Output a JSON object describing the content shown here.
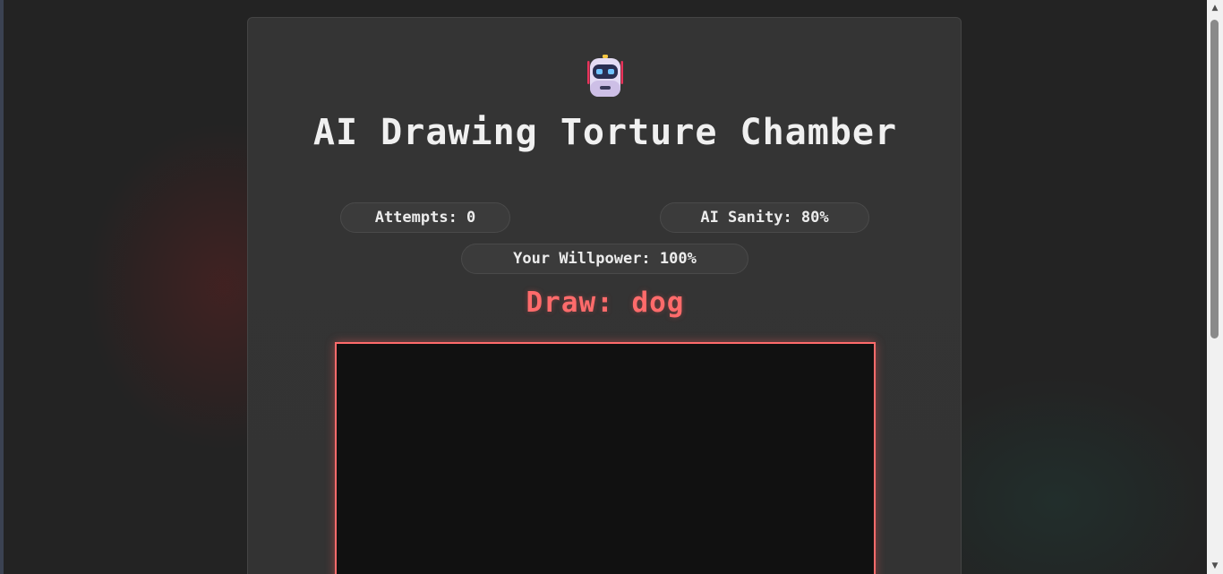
{
  "header": {
    "icon": "robot-icon",
    "title": "AI Drawing Torture Chamber"
  },
  "stats": {
    "attempts": "Attempts: 0",
    "sanity": "AI Sanity: 80%",
    "willpower": "Your Willpower: 100%"
  },
  "prompt": {
    "text": "Draw: dog"
  },
  "colors": {
    "accent": "#ff6b6b",
    "background": "#232323",
    "card": "#333333",
    "canvas": "#111111"
  }
}
